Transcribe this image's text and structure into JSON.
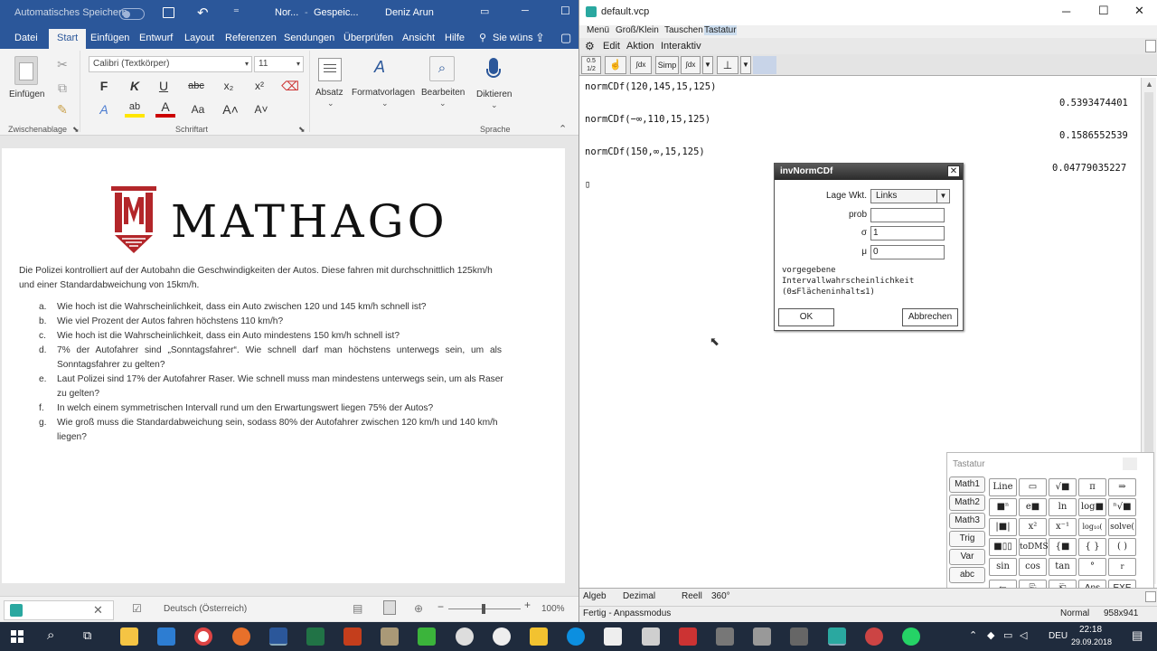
{
  "word": {
    "title_bar": {
      "autosave_label": "Automatisches Speichern",
      "doc_name": "Nor...",
      "saved_state": "Gespeic...",
      "user_name": "Deniz Arun"
    },
    "tabs": [
      "Datei",
      "Start",
      "Einfügen",
      "Entwurf",
      "Layout",
      "Referenzen",
      "Sendungen",
      "Überprüfen",
      "Ansicht",
      "Hilfe"
    ],
    "tell_me": "Sie wüns",
    "ribbon": {
      "paste_label": "Einfügen",
      "clipboard_group": "Zwischenablage",
      "font_name": "Calibri (Textkörper)",
      "font_size": "11",
      "font_group": "Schriftart",
      "bold": "F",
      "italic": "K",
      "underline": "U",
      "strike": "abc",
      "subscript": "x₂",
      "superscript": "x²",
      "paragraph_label": "Absatz",
      "styles_label": "Formatvorlagen",
      "editing_label": "Bearbeiten",
      "dictate_label": "Diktieren",
      "voice_group": "Sprache"
    },
    "document": {
      "logo_text": "MATHAGO",
      "intro_line1": "Die Polizei kontrolliert auf der Autobahn die Geschwindigkeiten der Autos. Diese fahren mit durchschnittlich 125km/h",
      "intro_line2": "und einer Standardabweichung von 15km/h.",
      "items": [
        {
          "marker": "a.",
          "line1": "Wie hoch ist die Wahrscheinlichkeit, dass ein Auto zwischen 120 und 145 km/h schnell ist?",
          "line2": ""
        },
        {
          "marker": "b.",
          "line1": "Wie viel Prozent der Autos fahren höchstens 110 km/h?",
          "line2": ""
        },
        {
          "marker": "c.",
          "line1": "Wie hoch ist die Wahrscheinlichkeit, dass ein Auto mindestens 150 km/h schnell ist?",
          "line2": ""
        },
        {
          "marker": "d.",
          "line1": "7% der Autofahrer sind „Sonntagsfahrer“. Wie schnell darf man höchstens unterwegs sein, um als",
          "line2": "Sonntagsfahrer zu gelten?"
        },
        {
          "marker": "e.",
          "line1": "Laut Polizei sind 17% der Autofahrer Raser. Wie schnell muss man mindestens unterwegs sein, um als Raser",
          "line2": "zu gelten?"
        },
        {
          "marker": "f.",
          "line1": "In welch einem symmetrischen Intervall rund um den Erwartungswert liegen 75% der Autos?",
          "line2": ""
        },
        {
          "marker": "g.",
          "line1": "Wie groß muss die Standardabweichung sein, sodass 80% der Autofahrer zwischen 120 km/h und 140 km/h",
          "line2": "liegen?"
        }
      ]
    },
    "status": {
      "language": "Deutsch (Österreich)",
      "zoom_minus": "−",
      "zoom_plus": "+",
      "zoom": "100%"
    }
  },
  "casio": {
    "title": "default.vcp",
    "menu": [
      "Menü",
      "Groß/Klein",
      "Tauschen",
      "Tastatur"
    ],
    "submenu": [
      "Edit",
      "Aktion",
      "Interaktiv"
    ],
    "toolbar": {
      "fraction": "0.5 1/2",
      "simp": "Simp"
    },
    "work": [
      {
        "input": "normCDf(120,145,15,125)",
        "output": "0.5393474401"
      },
      {
        "input": "normCDf(−∞,110,15,125)",
        "output": "0.1586552539"
      },
      {
        "input": "normCDf(150,∞,15,125)",
        "output": "0.04779035227"
      }
    ],
    "cursor": "▯",
    "dialog": {
      "title": "invNormCDf",
      "tail_label": "Lage Wkt.",
      "tail_value": "Links",
      "prob_label": "prob",
      "prob_value": "",
      "sigma_label": "σ",
      "sigma_value": "1",
      "mu_label": "μ",
      "mu_value": "0",
      "note_line1": "vorgegebene",
      "note_line2": "Intervallwahrscheinlichkeit",
      "note_line3": "(0≤Flächeninhalt≤1)",
      "ok": "OK",
      "cancel": "Abbrechen"
    },
    "keypad": {
      "title": "Tastatur",
      "side": [
        "Math1",
        "Math2",
        "Math3",
        "Trig",
        "Var",
        "abc"
      ],
      "rows": [
        [
          "Line",
          "▭",
          "√■",
          "π",
          "⇒"
        ],
        [
          "■ⁿ",
          "e■",
          "ln",
          "log■",
          "ⁿ√■"
        ],
        [
          "|■|",
          "x²",
          "x⁻¹",
          "log₁₀(",
          "solve("
        ],
        [
          "■▯▯",
          "toDMS",
          "{■",
          "{ }",
          "( )"
        ],
        [
          "sin",
          "cos",
          "tan",
          "°",
          "r"
        ],
        [
          "←",
          "⎘",
          "⎗",
          "Ans",
          "EXE"
        ]
      ]
    },
    "status": [
      "Algeb",
      "Dezimal",
      "Reell",
      "360°"
    ],
    "status2": {
      "left": "Fertig - Anpassmodus",
      "mode": "Normal",
      "size": "958x941"
    }
  },
  "taskbar": {
    "language": "DEU",
    "time": "22:18",
    "date": "29.09.2018"
  }
}
